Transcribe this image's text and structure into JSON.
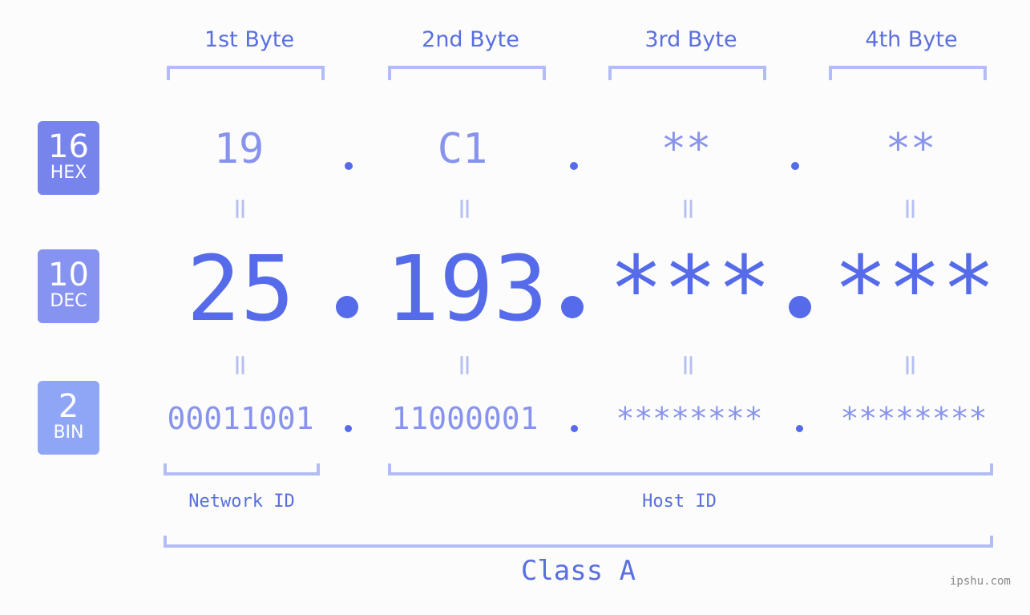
{
  "headers": [
    "1st Byte",
    "2nd Byte",
    "3rd Byte",
    "4th Byte"
  ],
  "bases": [
    {
      "num": "16",
      "label": "HEX",
      "color": "#7784ec"
    },
    {
      "num": "10",
      "label": "DEC",
      "color": "#8793f0"
    },
    {
      "num": "2",
      "label": "BIN",
      "color": "#8fa6f6"
    }
  ],
  "hex": [
    "19",
    "C1",
    "**",
    "**"
  ],
  "dec": [
    "25",
    "193",
    "***",
    "***"
  ],
  "bin": [
    "00011001",
    "11000001",
    "********",
    "********"
  ],
  "equals": "=",
  "network_label": "Network ID",
  "host_label": "Host ID",
  "class_label": "Class A",
  "watermark": "ipshu.com"
}
